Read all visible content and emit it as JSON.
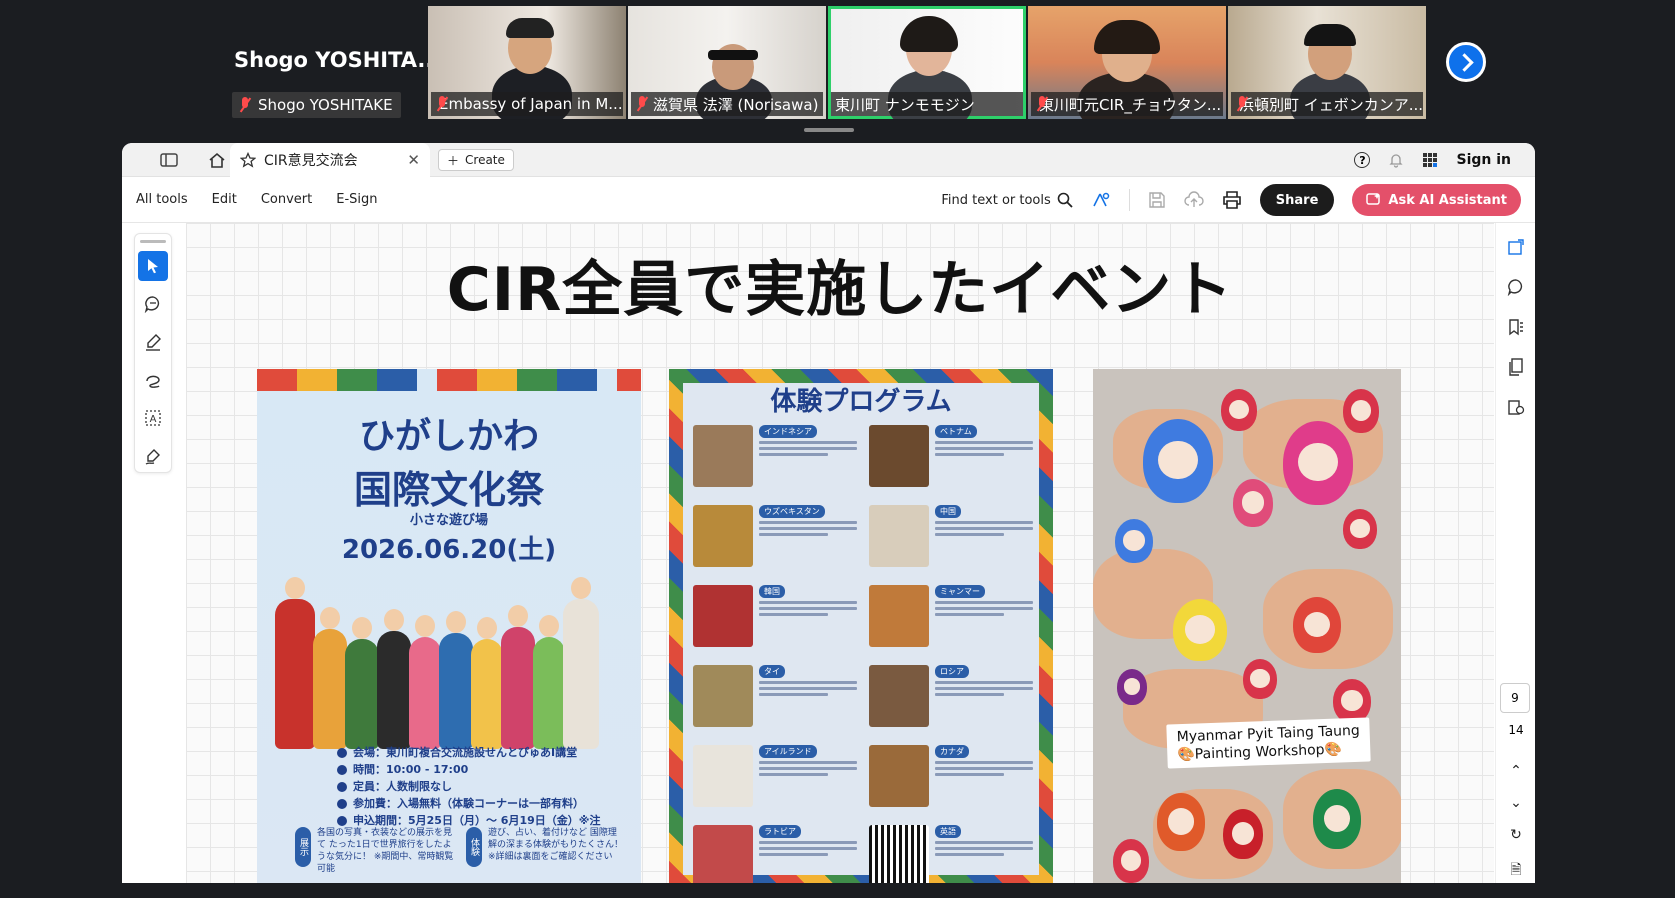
{
  "meeting": {
    "active_speaker": "Shogo YOSHITA...",
    "self_label": "Shogo YOSHITAKE",
    "participants": [
      {
        "name": "Embassy of Japan in M..."
      },
      {
        "name": "滋賀県 法澤 (Norisawa)"
      },
      {
        "name": "東川町  ナンモモジン"
      },
      {
        "name": "東川町元CIR_チョウタン..."
      },
      {
        "name": "浜頓別町  イェボンカンア..."
      }
    ]
  },
  "acrobat": {
    "tab_title": "CIR意見交流会",
    "create_label": "Create",
    "sign_in": "Sign in",
    "menu": [
      "All tools",
      "Edit",
      "Convert",
      "E-Sign"
    ],
    "find_label": "Find text or tools",
    "share_label": "Share",
    "ai_label": "Ask AI Assistant",
    "page_current": "9",
    "page_total": "14"
  },
  "slide": {
    "title": "CIR全員で実施したイベント",
    "poster1": {
      "title_line1": "ひがしかわ",
      "title_line2": "国際文化祭",
      "subtitle": "小さな遊び場",
      "date": "2026.06.20(土)",
      "info": [
        "会場：東川町複合交流施設せんとぴゅあⅠ講堂",
        "時間：10:00 - 17:00",
        "定員：人数制限なし",
        "参加費：入場無料（体験コーナーは一部有料）",
        "申込期間：5月25日（月）〜 6月19日（金）※注"
      ],
      "col1_tag": "展示",
      "col1_text": "各国の写真・衣装などの展示を見て たった1日で世界旅行をしたような気分に！ ※期間中、常時観覧可能",
      "col2_tag": "体験",
      "col2_text": "遊び、占い、着付けなど 国際理解の深まる体験がもりたくさん！ ※詳細は裏面をご確認ください"
    },
    "poster2": {
      "title": "体験プログラム",
      "tags": [
        "インドネシア",
        "ベトナム",
        "ウズベキスタン",
        "中国",
        "韓国",
        "ミャンマー",
        "タイ",
        "ロシア",
        "アイルランド",
        "カナダ",
        "ラトビア",
        "英語"
      ]
    },
    "photo_caption_line1": "Myanmar Pyit Taing Taung",
    "photo_caption_line2": "🎨Painting Workshop🎨"
  },
  "colors": {
    "accent_blue": "#1473e6",
    "ai_pink": "#e4506a",
    "active_tile": "#2ed06a"
  }
}
